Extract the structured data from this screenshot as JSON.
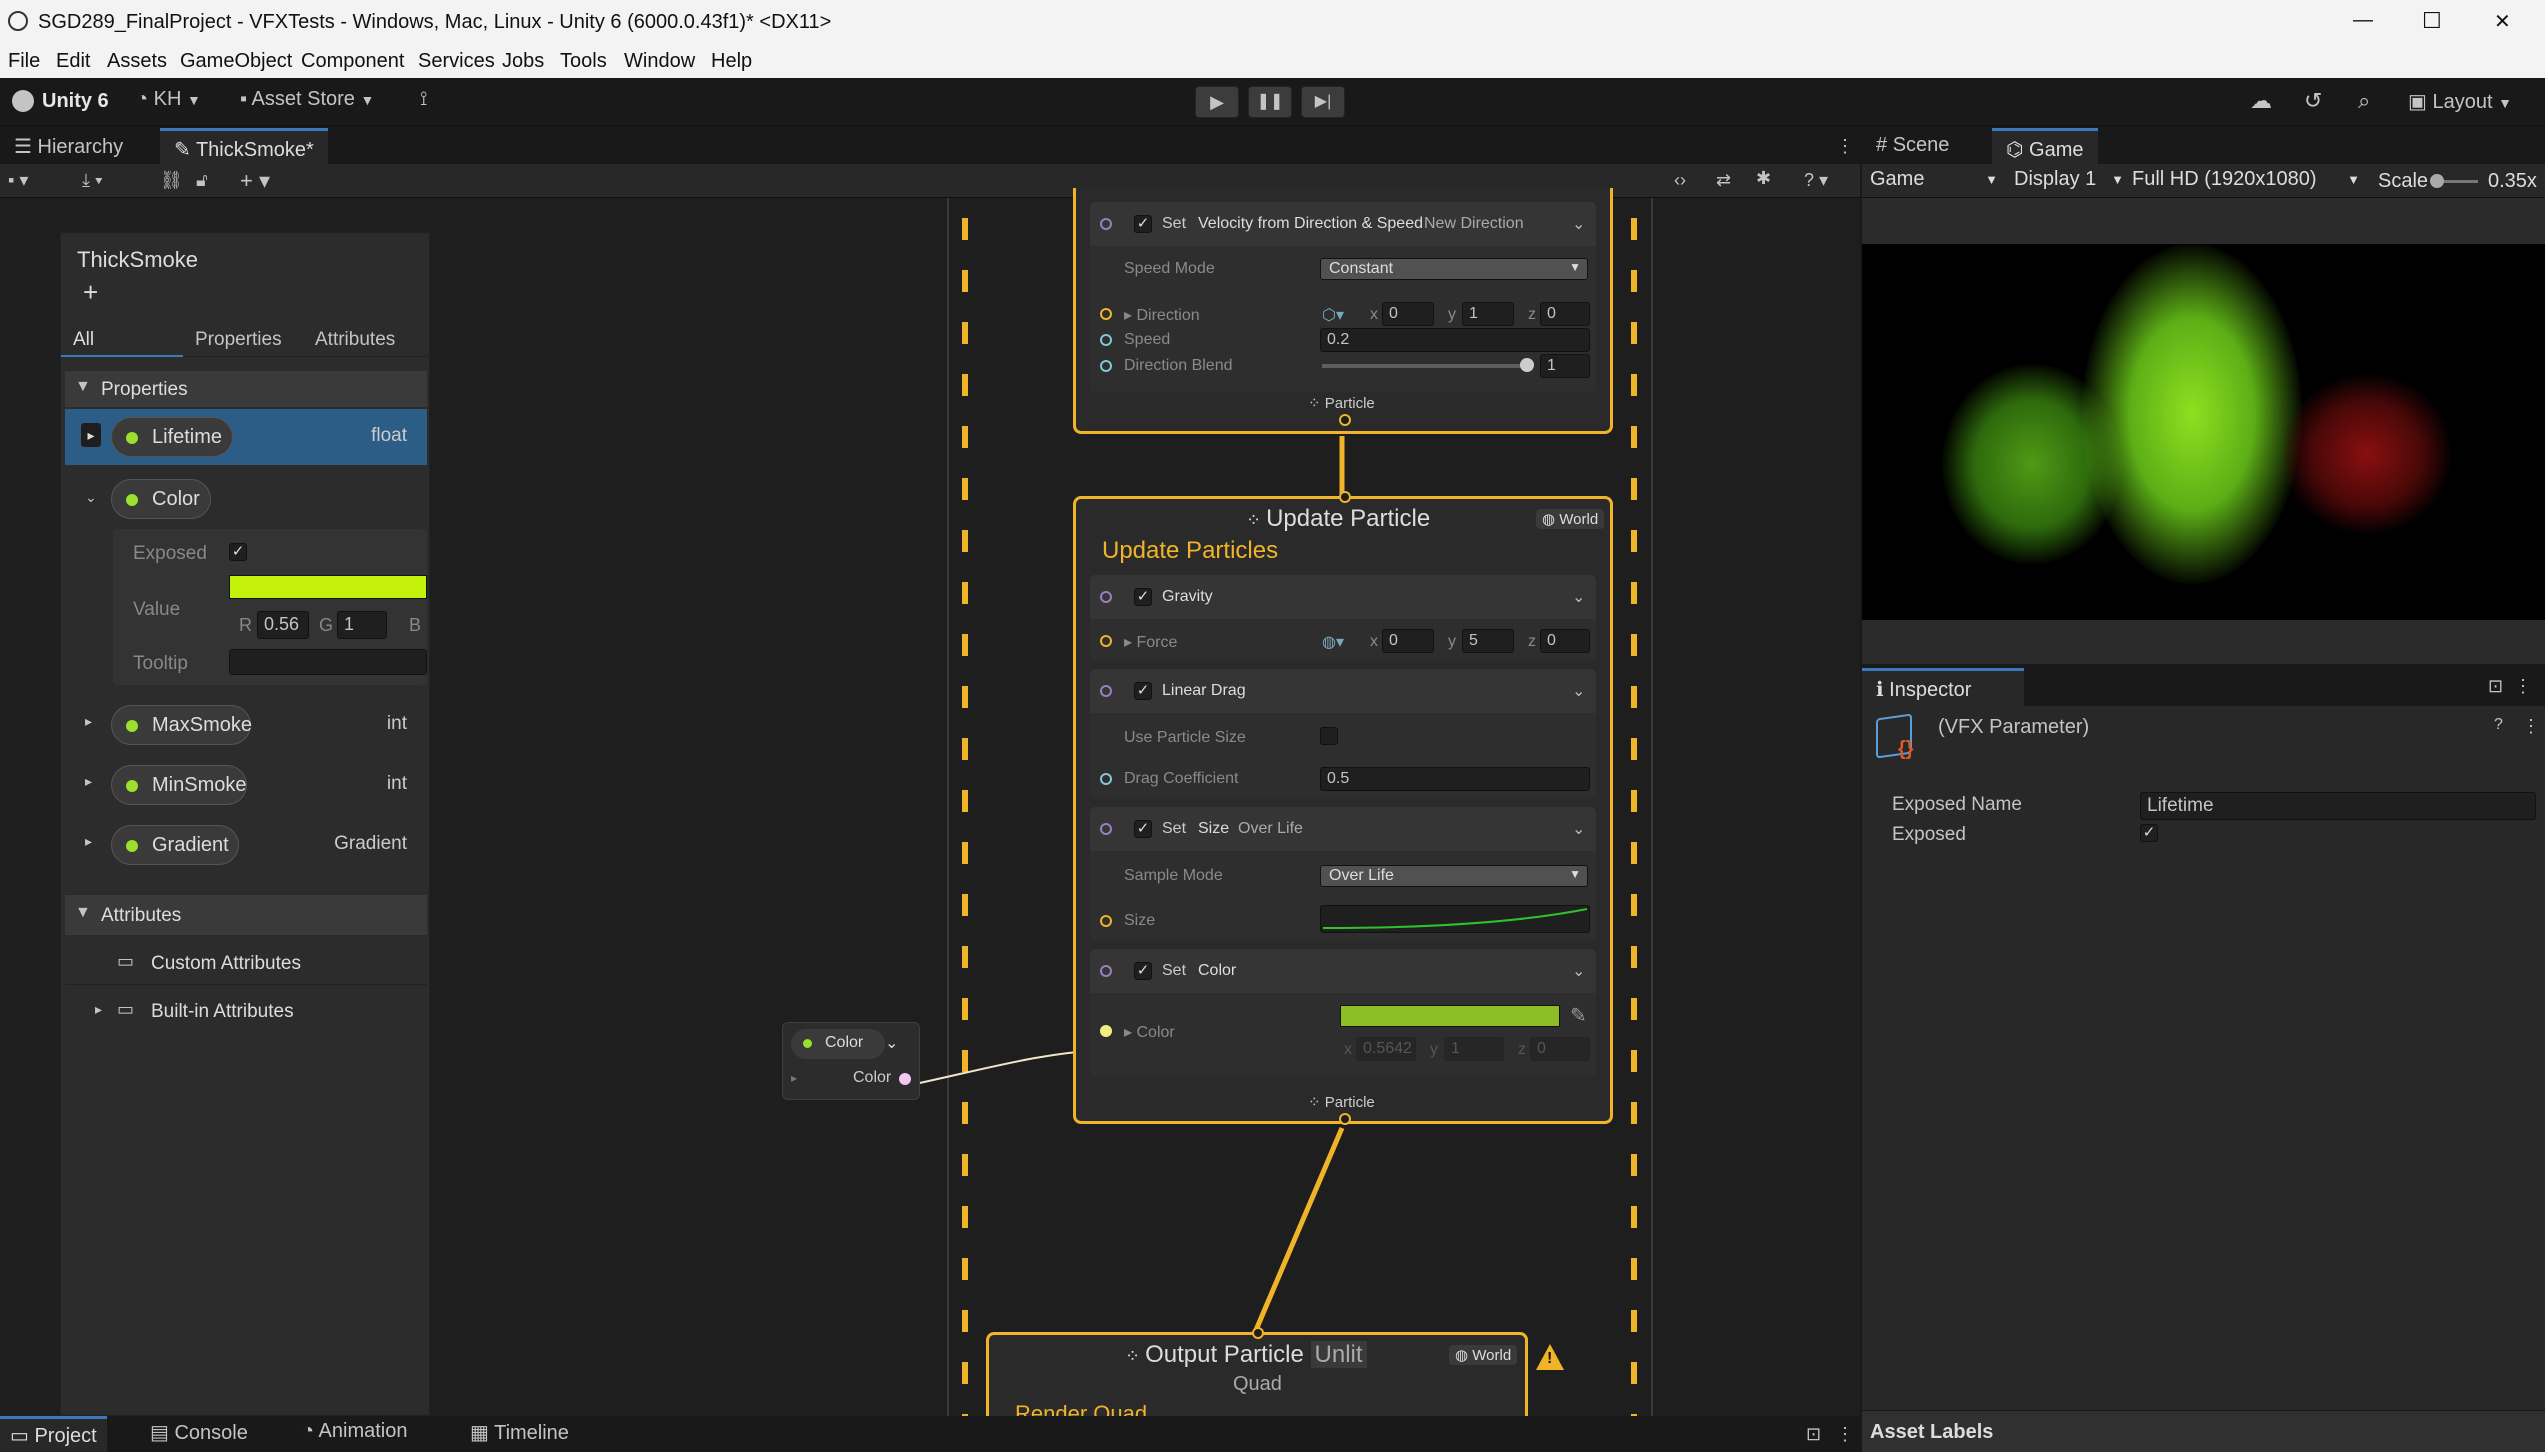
{
  "window": {
    "title": "SGD289_FinalProject - VFXTests - Windows, Mac, Linux - Unity 6 (6000.0.43f1)* <DX11>",
    "minimize_glyph": "—",
    "maximize_glyph": "☐",
    "close_glyph": "✕"
  },
  "menu": [
    "File",
    "Edit",
    "Assets",
    "GameObject",
    "Component",
    "Services",
    "Jobs",
    "Tools",
    "Window",
    "Help"
  ],
  "toolbar": {
    "brand": "Unity 6",
    "account": "KH",
    "asset_store": "Asset Store",
    "layout": "Layout"
  },
  "left_tabs": {
    "hierarchy": "Hierarchy",
    "graph_tab": "ThickSmoke*"
  },
  "blackboard": {
    "title": "ThickSmoke",
    "add": "+",
    "tabs": [
      "All",
      "Properties",
      "Attributes"
    ],
    "properties_header": "Properties",
    "attributes_header": "Attributes",
    "items": [
      {
        "name": "Lifetime",
        "type": "float"
      },
      {
        "name": "Color",
        "type": ""
      },
      {
        "name": "MaxSmoke",
        "type": "int"
      },
      {
        "name": "MinSmoke",
        "type": "int"
      },
      {
        "name": "Gradient",
        "type": "Gradient"
      }
    ],
    "color_details": {
      "exposed_label": "Exposed",
      "value_label": "Value",
      "tooltip_label": "Tooltip",
      "r_label": "R",
      "r": "0.56",
      "g_label": "G",
      "g": "1",
      "b_label": "B",
      "swatch": "#c5f20a",
      "check": "✓"
    },
    "custom_attributes": "Custom Attributes",
    "builtin_attributes": "Built-in Attributes"
  },
  "graph": {
    "velocity_block": {
      "set": "Set",
      "title": "Velocity from Direction & Speed",
      "suffix": "New Direction",
      "speed_mode_label": "Speed Mode",
      "speed_mode": "Constant",
      "direction_label": "Direction",
      "dx_label": "x",
      "dx": "0",
      "dy_label": "y",
      "dy": "1",
      "dz_label": "z",
      "dz": "0",
      "speed_label": "Speed",
      "speed": "0.2",
      "blend_label": "Direction Blend",
      "blend": "1",
      "blend_fraction": 1.0
    },
    "flow_label_1": "Particle",
    "update": {
      "title": "Update Particle",
      "space": "World",
      "subtitle": "Update Particles",
      "gravity": "Gravity",
      "force_label": "Force",
      "fx_label": "x",
      "fx": "0",
      "fy_label": "y",
      "fy": "5",
      "fz_label": "z",
      "fz": "0",
      "linear_drag": "Linear Drag",
      "use_particle_size": "Use Particle Size",
      "drag_coef_label": "Drag Coefficient",
      "drag_coef": "0.5",
      "size_set": "Set",
      "size_name": "Size",
      "size_suffix": "Over Life",
      "sample_mode_label": "Sample Mode",
      "sample_mode": "Over Life",
      "size_label": "Size",
      "color_set": "Set",
      "color_name": "Color",
      "color_label": "Color",
      "color_swatch": "#8cbf26",
      "cx_label": "x",
      "cx": "0.5642",
      "cy_label": "y",
      "cy": "1",
      "cz_label": "z",
      "cz": "0"
    },
    "flow_label_2": "Particle",
    "output": {
      "title": "Output Particle",
      "mode": "Unlit",
      "subtitle": "Quad",
      "space": "World",
      "context": "Render Quad",
      "warning": "!"
    },
    "color_node": {
      "title": "Color",
      "port": "Color"
    }
  },
  "right_tabs": {
    "scene": "Scene",
    "game": "Game"
  },
  "game_bar": {
    "mode": "Game",
    "display": "Display 1",
    "resolution": "Full HD (1920x1080)",
    "scale_label": "Scale",
    "scale": "0.35x",
    "scale_fraction": 0.05
  },
  "inspector": {
    "tab": "Inspector",
    "object": "(VFX Parameter)",
    "exposed_name_label": "Exposed Name",
    "exposed_name": "Lifetime",
    "exposed_label": "Exposed",
    "check": "✓",
    "asset_labels": "Asset Labels"
  },
  "bottom_tabs": [
    "Project",
    "Console",
    "Animation",
    "Timeline"
  ],
  "colors": {
    "accent_yellow": "#f0b429",
    "selection_blue": "#2c5d87",
    "tab_blue": "#3a79bb",
    "orange": "#f0b429"
  }
}
